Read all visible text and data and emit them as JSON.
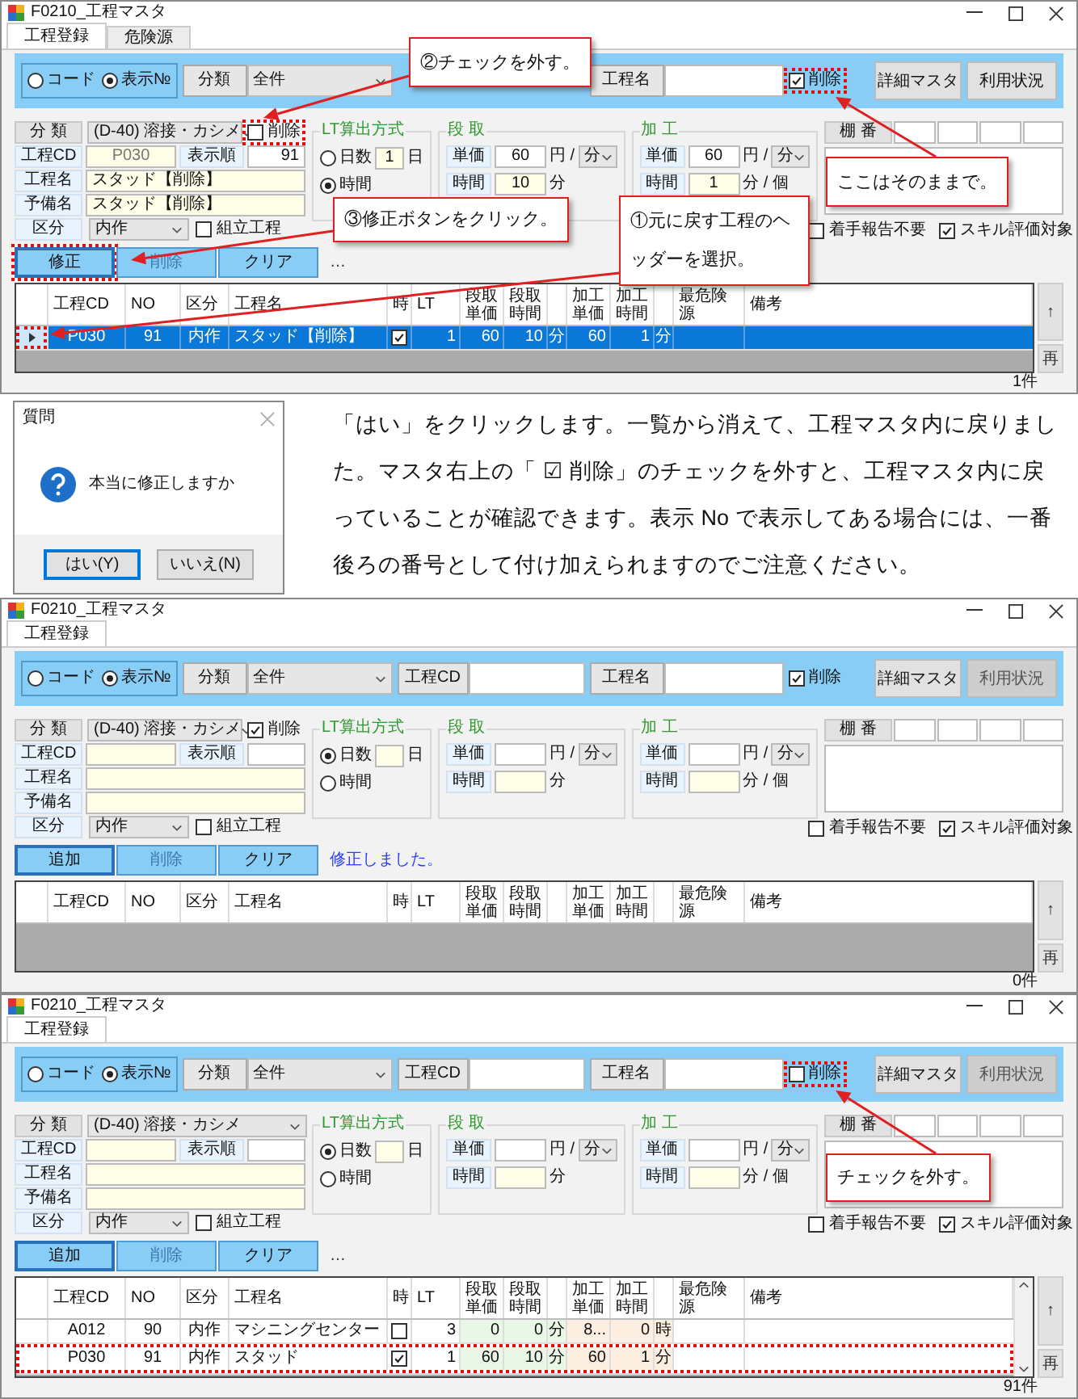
{
  "windows": [
    {
      "title": "F0210_工程マスタ",
      "tabs": [
        {
          "label": "工程登録",
          "selected": true
        },
        {
          "label": "危険源",
          "selected": false
        }
      ],
      "search": {
        "modes": [
          {
            "label": "コード",
            "selected": false
          },
          {
            "label": "表示№",
            "selected": true
          }
        ],
        "category_label": "分類",
        "category": "全件",
        "name_label": "工程名",
        "deleted": {
          "label": "削除",
          "checked": true,
          "highlighted": true
        },
        "buttons": [
          {
            "label": "詳細マスタ",
            "disabled": false
          },
          {
            "label": "利用状況",
            "disabled": false
          }
        ]
      },
      "form": {
        "category": {
          "label": "分 類",
          "value": "(D-40) 溶接・カシメ"
        },
        "deleted": {
          "label": "削除",
          "checked": false,
          "highlighted": true
        },
        "code": {
          "label": "工程CD",
          "value": "P030"
        },
        "order": {
          "label": "表示順",
          "value": "91"
        },
        "name": {
          "label": "工程名",
          "value": "スタッド【削除】"
        },
        "alias": {
          "label": "予備名",
          "value": "スタッド【削除】"
        },
        "division": {
          "label": "区分",
          "value": "内作"
        },
        "assembly": {
          "label": "組立工程",
          "checked": false
        },
        "lt": {
          "title": "LT算出方式",
          "options": [
            {
              "label": "日数",
              "selected": false
            },
            {
              "label": "時間",
              "selected": true
            }
          ],
          "days": "1",
          "unit": "日"
        },
        "setup": {
          "title": "段 取",
          "price_label": "単価",
          "price": "60",
          "price_unit": "円 /",
          "per": "分",
          "time_label": "時間",
          "time": "10",
          "time_unit": "分"
        },
        "process": {
          "title": "加 工",
          "price_label": "単価",
          "price": "60",
          "price_unit": "円 /",
          "per": "分",
          "time_label": "時間",
          "time": "1",
          "time_unit": "分 / 個"
        },
        "shelf": {
          "label": "棚 番"
        },
        "options": [
          {
            "label": "着手報告不要",
            "checked": false
          },
          {
            "label": "スキル評価対象",
            "checked": true
          }
        ]
      },
      "actions": [
        {
          "label": "修正",
          "focused": true,
          "disabled": false,
          "highlighted": true
        },
        {
          "label": "削除",
          "focused": false,
          "disabled": true
        },
        {
          "label": "クリア",
          "focused": false,
          "disabled": false
        }
      ],
      "more": "…",
      "table": {
        "columns": [
          {
            "kind": "text",
            "label": "工程CD"
          },
          {
            "kind": "text",
            "label": "NO"
          },
          {
            "kind": "text",
            "label": "区分"
          },
          {
            "kind": "text",
            "label": "工程名"
          },
          {
            "kind": "text",
            "label": "時"
          },
          {
            "kind": "text",
            "label": "LT"
          },
          {
            "kind": "text",
            "label": "段取単価"
          },
          {
            "kind": "text",
            "label": "段取時間"
          },
          {
            "kind": "blank"
          },
          {
            "kind": "text",
            "label": "加工単価"
          },
          {
            "kind": "text",
            "label": "加工時間"
          },
          {
            "kind": "blank"
          },
          {
            "kind": "text",
            "label": "最危険源"
          },
          {
            "kind": "text",
            "label": "備考"
          }
        ],
        "rows": [
          {
            "selected": true,
            "current": true,
            "marker_highlighted": true,
            "cells": [
              "P030",
              "91",
              "内作",
              "スタッド【削除】"
            ],
            "hour_checked": true,
            "figures": [
              "1",
              "60",
              "10",
              "分",
              "60",
              "1",
              "分"
            ]
          }
        ],
        "side_buttons": [
          "↑",
          "再"
        ],
        "count": "1件"
      },
      "callouts": [
        {
          "text": "②チェックを外す。"
        },
        {
          "text": "ここはそのままで。"
        },
        {
          "text": "③修正ボタンをクリック。"
        },
        {
          "text": "①元に戻す工程のヘッダーを選択。"
        }
      ]
    },
    {
      "title": "F0210_工程マスタ",
      "tabs": [
        {
          "label": "工程登録",
          "selected": true
        }
      ],
      "search": {
        "modes": [
          {
            "label": "コード",
            "selected": false
          },
          {
            "label": "表示№",
            "selected": true
          }
        ],
        "category_label": "分類",
        "category": "全件",
        "cd_label": "工程CD",
        "name_label": "工程名",
        "deleted": {
          "label": "削除",
          "checked": true
        },
        "buttons": [
          {
            "label": "詳細マスタ",
            "disabled": false
          },
          {
            "label": "利用状況",
            "disabled": true
          }
        ]
      },
      "form": {
        "category": {
          "label": "分 類",
          "value": "(D-40) 溶接・カシメ"
        },
        "deleted": {
          "label": "削除",
          "checked": true
        },
        "code": {
          "label": "工程CD"
        },
        "order": {
          "label": "表示順"
        },
        "name": {
          "label": "工程名"
        },
        "alias": {
          "label": "予備名"
        },
        "division": {
          "label": "区分",
          "value": "内作"
        },
        "assembly": {
          "label": "組立工程",
          "checked": false
        },
        "lt": {
          "title": "LT算出方式",
          "options": [
            {
              "label": "日数",
              "selected": true
            },
            {
              "label": "時間",
              "selected": false
            }
          ],
          "unit": "日"
        },
        "setup": {
          "title": "段 取",
          "price_label": "単価",
          "price_unit": "円 /",
          "per": "分",
          "time_label": "時間",
          "time_unit": "分"
        },
        "process": {
          "title": "加 工",
          "price_label": "単価",
          "price_unit": "円 /",
          "per": "分",
          "time_label": "時間",
          "time_unit": "分 / 個"
        },
        "shelf": {
          "label": "棚 番"
        },
        "options": [
          {
            "label": "着手報告不要",
            "checked": false
          },
          {
            "label": "スキル評価対象",
            "checked": true
          }
        ]
      },
      "actions": [
        {
          "label": "追加",
          "focused": true,
          "disabled": false
        },
        {
          "label": "削除",
          "focused": false,
          "disabled": true
        },
        {
          "label": "クリア",
          "focused": false,
          "disabled": false
        }
      ],
      "message": "修正しました。",
      "table": {
        "columns": [
          {
            "kind": "text",
            "label": "工程CD"
          },
          {
            "kind": "text",
            "label": "NO"
          },
          {
            "kind": "text",
            "label": "区分"
          },
          {
            "kind": "text",
            "label": "工程名"
          },
          {
            "kind": "text",
            "label": "時"
          },
          {
            "kind": "text",
            "label": "LT"
          },
          {
            "kind": "text",
            "label": "段取単価"
          },
          {
            "kind": "text",
            "label": "段取時間"
          },
          {
            "kind": "blank"
          },
          {
            "kind": "text",
            "label": "加工単価"
          },
          {
            "kind": "text",
            "label": "加工時間"
          },
          {
            "kind": "blank"
          },
          {
            "kind": "text",
            "label": "最危険源"
          },
          {
            "kind": "text",
            "label": "備考"
          }
        ],
        "side_buttons": [
          "↑",
          "再"
        ],
        "count": "0件"
      }
    },
    {
      "title": "F0210_工程マスタ",
      "tabs": [
        {
          "label": "工程登録",
          "selected": true
        }
      ],
      "search": {
        "modes": [
          {
            "label": "コード",
            "selected": false
          },
          {
            "label": "表示№",
            "selected": true
          }
        ],
        "category_label": "分類",
        "category": "全件",
        "cd_label": "工程CD",
        "name_label": "工程名",
        "deleted": {
          "label": "削除",
          "checked": false,
          "highlighted": true
        },
        "buttons": [
          {
            "label": "詳細マスタ",
            "disabled": false
          },
          {
            "label": "利用状況",
            "disabled": true
          }
        ]
      },
      "form": {
        "category": {
          "label": "分 類",
          "value": "(D-40) 溶接・カシメ"
        },
        "code": {
          "label": "工程CD"
        },
        "order": {
          "label": "表示順"
        },
        "name": {
          "label": "工程名"
        },
        "alias": {
          "label": "予備名"
        },
        "division": {
          "label": "区分",
          "value": "内作"
        },
        "assembly": {
          "label": "組立工程",
          "checked": false
        },
        "lt": {
          "title": "LT算出方式",
          "options": [
            {
              "label": "日数",
              "selected": true
            },
            {
              "label": "時間",
              "selected": false
            }
          ],
          "unit": "日"
        },
        "setup": {
          "title": "段 取",
          "price_label": "単価",
          "price_unit": "円 /",
          "per": "分",
          "time_label": "時間",
          "time_unit": "分"
        },
        "process": {
          "title": "加 工",
          "price_label": "単価",
          "price_unit": "円 /",
          "per": "分",
          "time_label": "時間",
          "time_unit": "分 / 個"
        },
        "shelf": {
          "label": "棚 番"
        },
        "options": [
          {
            "label": "着手報告不要",
            "checked": false
          },
          {
            "label": "スキル評価対象",
            "checked": true
          }
        ]
      },
      "actions": [
        {
          "label": "追加",
          "focused": true,
          "disabled": false
        },
        {
          "label": "削除",
          "focused": false,
          "disabled": true
        },
        {
          "label": "クリア",
          "focused": false,
          "disabled": false
        }
      ],
      "more": "…",
      "table": {
        "columns": [
          {
            "kind": "text",
            "label": "工程CD"
          },
          {
            "kind": "text",
            "label": "NO"
          },
          {
            "kind": "text",
            "label": "区分"
          },
          {
            "kind": "text",
            "label": "工程名"
          },
          {
            "kind": "text",
            "label": "時"
          },
          {
            "kind": "text",
            "label": "LT"
          },
          {
            "kind": "text",
            "label": "段取単価"
          },
          {
            "kind": "text",
            "label": "段取時間"
          },
          {
            "kind": "blank"
          },
          {
            "kind": "text",
            "label": "加工単価"
          },
          {
            "kind": "text",
            "label": "加工時間"
          },
          {
            "kind": "blank"
          },
          {
            "kind": "text",
            "label": "最危険源"
          },
          {
            "kind": "text",
            "label": "備考"
          }
        ],
        "rows": [
          {
            "selected": false,
            "current": false,
            "cells": [
              "A012",
              "90",
              "内作",
              "マシニングセンター"
            ],
            "hour_checked": false,
            "figures": [
              "3",
              "0",
              "0",
              "分",
              "8...",
              "0",
              "時"
            ]
          },
          {
            "selected": false,
            "current": false,
            "highlighted": true,
            "cells": [
              "P030",
              "91",
              "内作",
              "スタッド"
            ],
            "hour_checked": true,
            "figures": [
              "1",
              "60",
              "10",
              "分",
              "60",
              "1",
              "分"
            ]
          }
        ],
        "scrollbar": true,
        "side_buttons": [
          "↑",
          "再"
        ],
        "count": "91件"
      },
      "callouts": [
        {
          "text": "チェックを外す。"
        }
      ]
    }
  ],
  "dialog": {
    "title": "質問",
    "message": "本当に修正しますか",
    "buttons": [
      {
        "label": "はい(Y)",
        "focused": true
      },
      {
        "label": "いいえ(N)",
        "focused": false
      }
    ]
  },
  "explanation": "「はい」をクリックします。一覧から消えて、工程マスタ内に戻りました。マスタ右上の「 ☑ 削除」のチェックを外すと、工程マスタ内に戻っていることが確認できます。表示 No で表示してある場合には、一番後ろの番号として付け加えられますのでご注意ください。"
}
